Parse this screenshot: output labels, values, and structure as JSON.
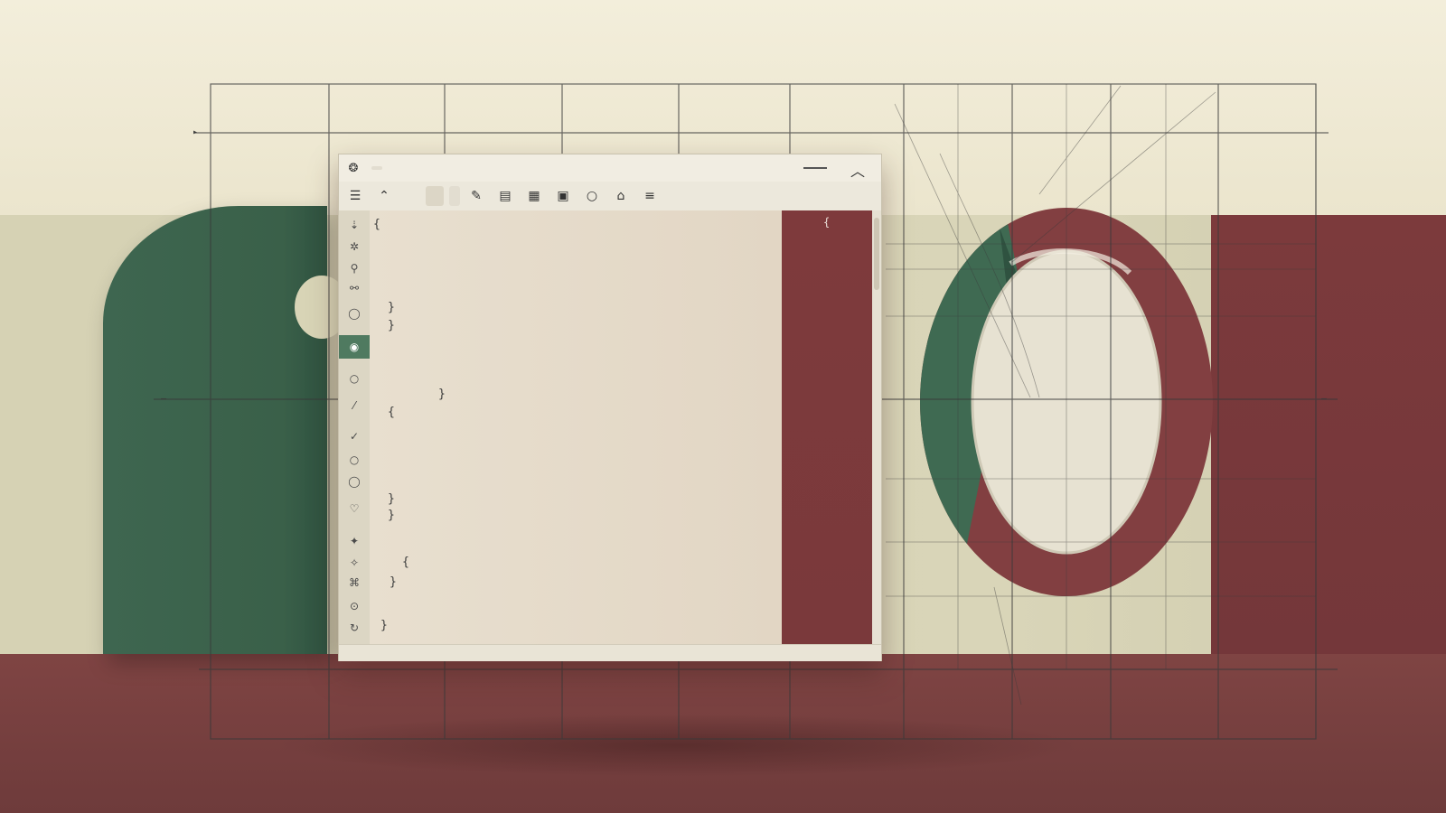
{
  "window": {
    "app_icon": "editor-app-icon",
    "title": "",
    "path": "",
    "tab_close": "",
    "minimize_icon": "minimize-icon",
    "collapse_icon": "chevron-up-icon"
  },
  "toolbar": {
    "menu_icon": "hamburger-menu-icon",
    "up_icon": "caret-up-icon",
    "btn1": "",
    "btn2": "",
    "btn3": "",
    "icons": [
      "edit-icon",
      "layout-icon",
      "save-icon",
      "clipboard-icon",
      "circle-icon",
      "bell-icon",
      "menu-icon"
    ]
  },
  "gutter": {
    "icons": [
      "arrow-icon",
      "sparkle-icon",
      "bookmark-icon",
      "link-icon",
      "circle-icon",
      "eye-icon",
      "circle-icon",
      "pen-icon",
      "check-icon",
      "circle-icon",
      "circle-icon",
      "heart-icon",
      "star-icon",
      "sparkle-icon",
      "tag-icon",
      "dot-icon",
      "refresh-icon"
    ]
  },
  "code": {
    "lines": [
      {
        "text": "{ ",
        "color": "#3a3a3a"
      },
      {
        "text": "",
        "color": "#3a3a3a"
      },
      {
        "text": "",
        "color": "#3a3a3a"
      },
      {
        "text": "",
        "color": "#3a3a3a"
      },
      {
        "text": "}",
        "color": "#3a3a3a"
      },
      {
        "text": "}",
        "color": "#3a3a3a"
      },
      {
        "text": "",
        "color": "#b03a3a"
      },
      {
        "text": "",
        "color": "#2f2f6a"
      },
      {
        "text": "}",
        "color": "#3a3a3a"
      },
      {
        "text": "{",
        "color": "#3a3a3a"
      },
      {
        "text": "",
        "color": "#b03a3a"
      },
      {
        "text": "",
        "color": "#3c7a3c"
      },
      {
        "text": "",
        "color": "#3c7a3c"
      },
      {
        "text": "}",
        "color": "#3a3a3a"
      },
      {
        "text": "}",
        "color": "#3a3a3a"
      },
      {
        "text": "",
        "color": "#b03a3a"
      },
      {
        "text": "{",
        "color": "#3a3a3a"
      },
      {
        "text": "}",
        "color": "#3a3a3a"
      },
      {
        "text": "",
        "color": "#b03a3a"
      },
      {
        "text": "}",
        "color": "#3a3a3a"
      }
    ]
  },
  "side_panel": {
    "mark": "{"
  },
  "colors": {
    "green": "#3e6650",
    "maroon": "#7c3a3c",
    "cream": "#efe8d3"
  }
}
